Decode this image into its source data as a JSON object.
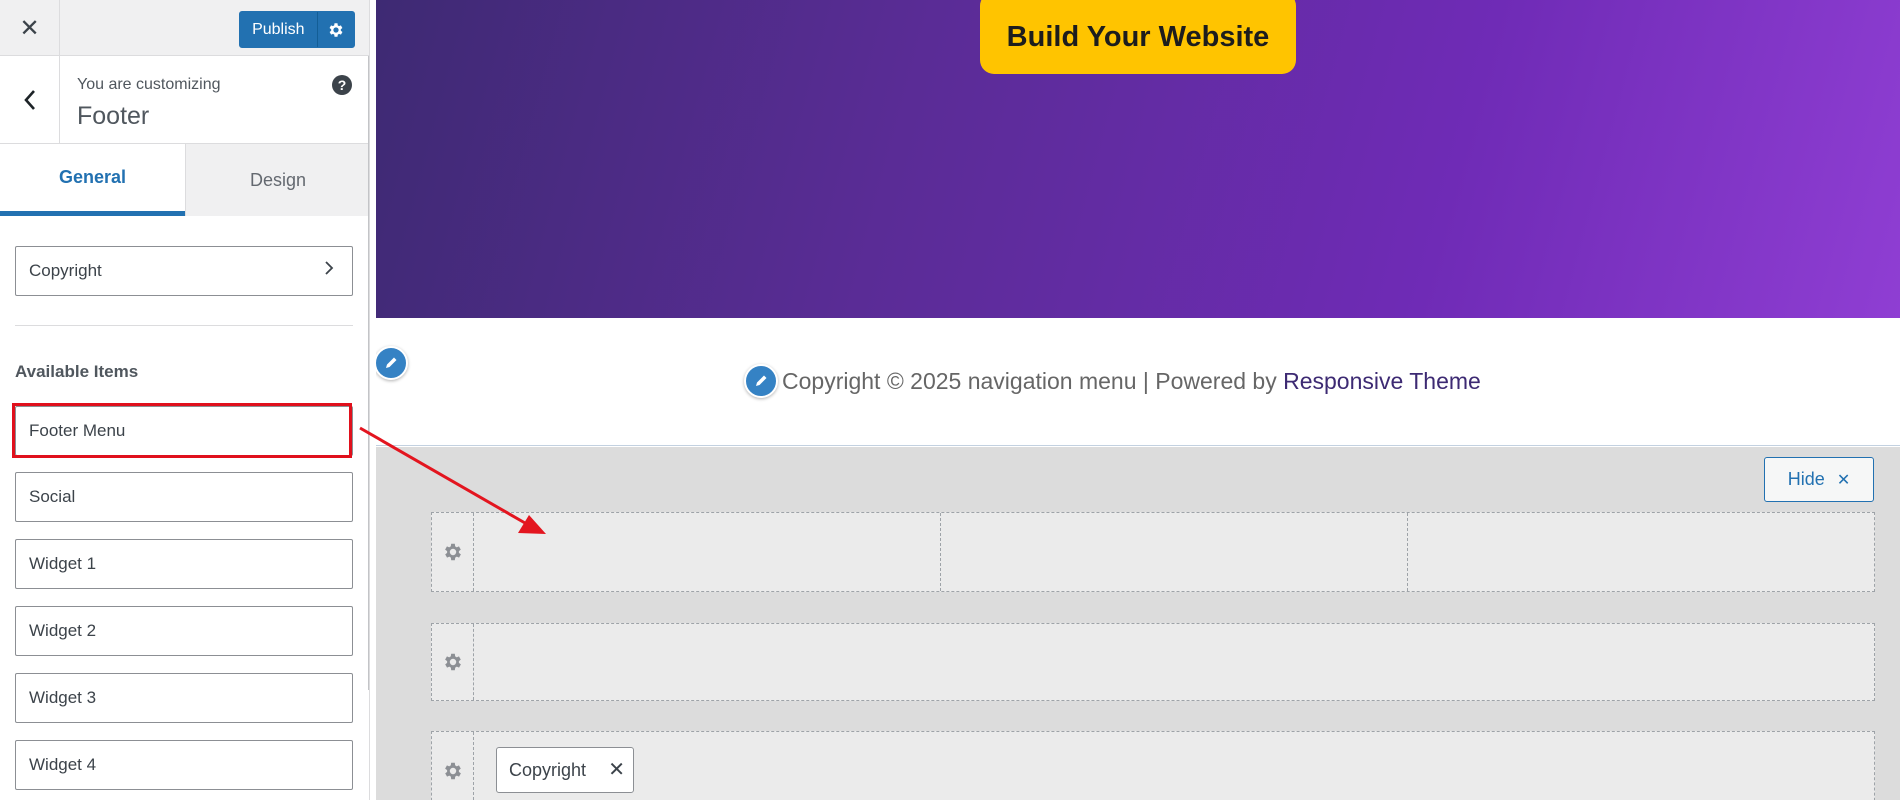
{
  "topbar": {
    "close_glyph": "✕",
    "publish_label": "Publish"
  },
  "header": {
    "customizing_label": "You are customizing",
    "section_title": "Footer",
    "help_glyph": "?"
  },
  "tabs": [
    {
      "label": "General",
      "active": true
    },
    {
      "label": "Design",
      "active": false
    }
  ],
  "panel": {
    "selected_item": "Copyright",
    "available_heading": "Available Items",
    "available_items": [
      "Footer Menu",
      "Social",
      "Widget 1",
      "Widget 2",
      "Widget 3",
      "Widget 4"
    ],
    "highlighted_item": "Footer Menu"
  },
  "hero": {
    "cta_label": "Build Your Website"
  },
  "site_footer": {
    "copyright_text": "Copyright © 2025 navigation menu | Powered by ",
    "theme_link": "Responsive Theme"
  },
  "builder": {
    "hide_label": "Hide",
    "hide_glyph": "✕",
    "chip_label": "Copyright",
    "chip_remove_glyph": "✕"
  },
  "colors": {
    "accent": "#2271b1",
    "highlight": "#e0101c",
    "cta": "#ffc400",
    "hero_start": "#3e2a73",
    "hero_end": "#8f3ed3"
  }
}
